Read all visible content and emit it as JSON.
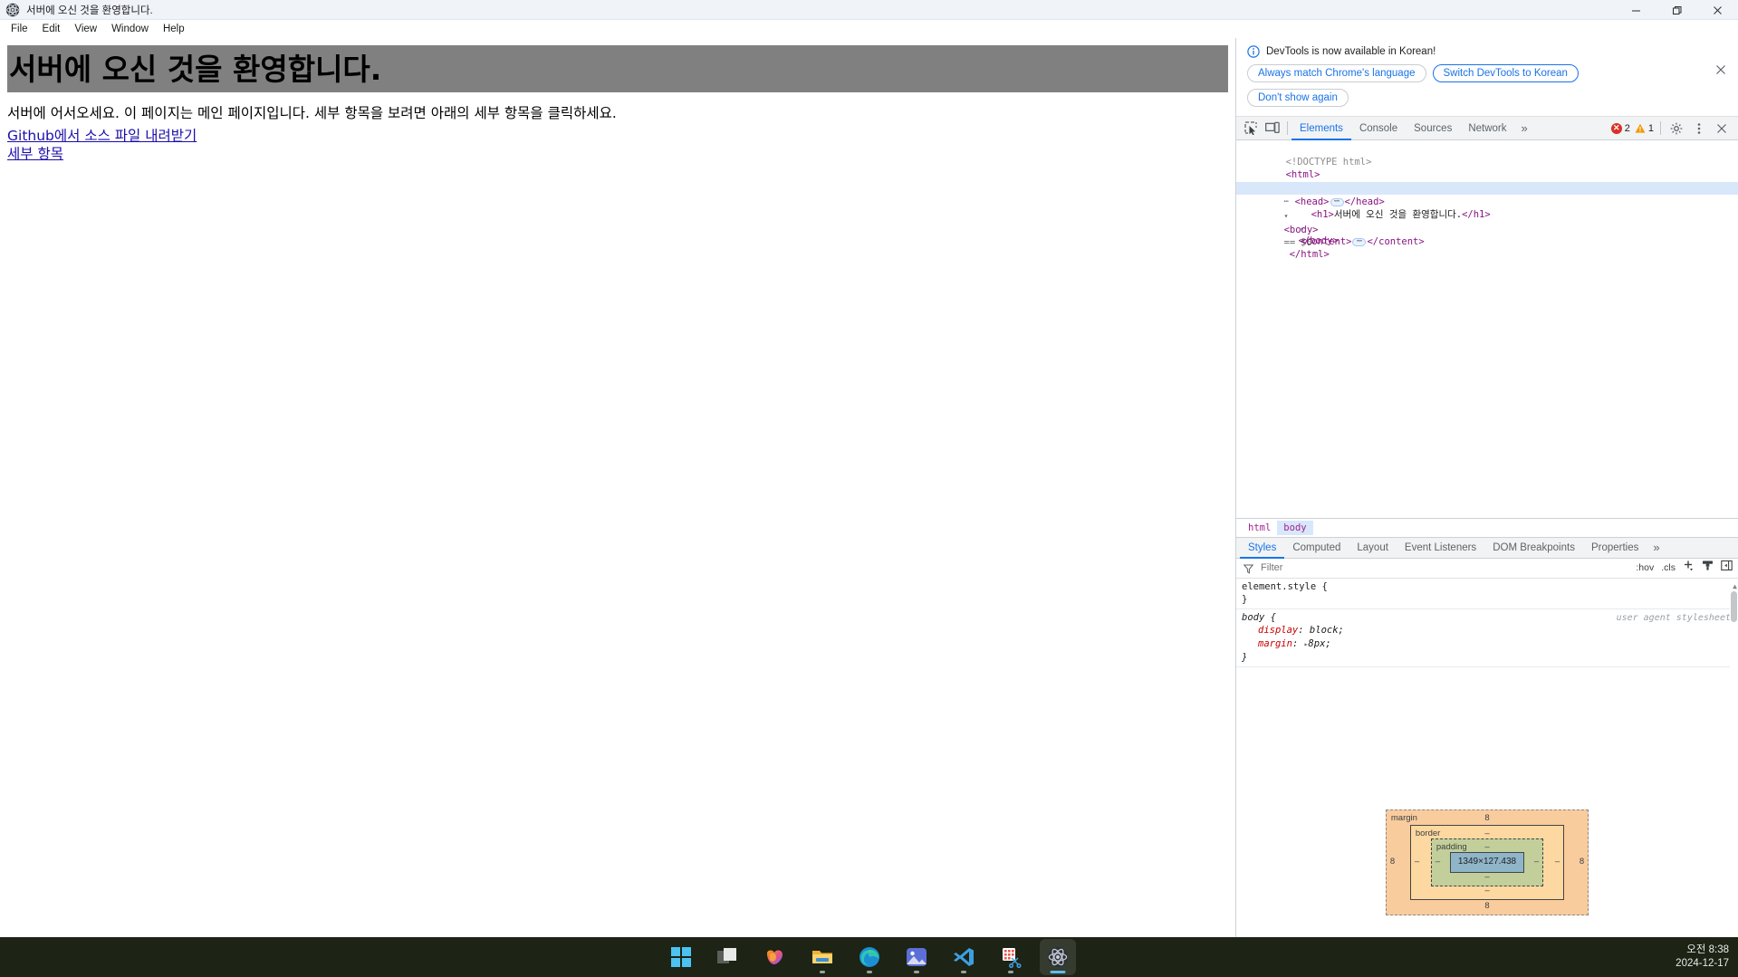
{
  "window": {
    "title": "서버에 오신 것을 환영합니다.",
    "app_icon": "electron-atom-icon",
    "minimize": "—",
    "maximize": "❐",
    "close": "✕"
  },
  "menubar": {
    "items": [
      "File",
      "Edit",
      "View",
      "Window",
      "Help"
    ]
  },
  "page": {
    "heading": "서버에 오신 것을 환영합니다.",
    "paragraph": "서버에 어서오세요. 이 페이지는 메인 페이지입니다. 세부 항목을 보려면 아래의 세부 항목을 클릭하세요.",
    "links": [
      "Github에서 소스 파일 내려받기",
      "세부 항목"
    ],
    "highlight_color": "#808080",
    "link_color": "#1a0dab"
  },
  "devtools": {
    "notice": {
      "icon": "info-icon",
      "message": "DevTools is now available in Korean!",
      "buttons": [
        "Always match Chrome's language",
        "Switch DevTools to Korean",
        "Don't show again"
      ],
      "close": "✕"
    },
    "toolbar": {
      "inspect_icon": "inspect-element-icon",
      "device_icon": "device-toolbar-icon",
      "tabs": [
        "Elements",
        "Console",
        "Sources",
        "Network"
      ],
      "active_tab": "Elements",
      "more_tabs": "»",
      "errors": "2",
      "warnings": "1",
      "settings_icon": "gear-icon",
      "menu_icon": "kebab-menu-icon",
      "close_icon": "close-icon"
    },
    "dom_tree": [
      {
        "indent": 1,
        "kind": "doctype",
        "text": "<!DOCTYPE html>"
      },
      {
        "indent": 1,
        "kind": "tag",
        "text": "<html>"
      },
      {
        "indent": 2,
        "kind": "collapsed",
        "arrow": "▸",
        "open": "<head>",
        "close": "</head>"
      },
      {
        "indent": 1,
        "kind": "selected",
        "arrow": "▾",
        "open": "<body>",
        "suffix": "== $0"
      },
      {
        "indent": 3,
        "kind": "text-node",
        "open": "<h1>",
        "text": "서버에 오신 것을 환영합니다.",
        "close": "</h1>"
      },
      {
        "indent": 2,
        "kind": "collapsed",
        "arrow": "▸",
        "open": "<content>",
        "close": "</content>"
      },
      {
        "indent": 2,
        "kind": "tag",
        "text": "</body>"
      },
      {
        "indent": 1,
        "kind": "tag",
        "text": "</html>"
      }
    ],
    "breadcrumbs": [
      "html",
      "body"
    ],
    "breadcrumb_active": "body",
    "sub_tabs": [
      "Styles",
      "Computed",
      "Layout",
      "Event Listeners",
      "DOM Breakpoints",
      "Properties"
    ],
    "sub_tab_active": "Styles",
    "sub_tabs_more": "»",
    "filter": {
      "icon": "filter-icon",
      "placeholder": "Filter",
      "value": "",
      "tools": [
        ":hov",
        ".cls"
      ],
      "add_rule_icon": "plus-icon",
      "class_icon": "paintbrush-icon",
      "sidebar_icon": "toggle-sidebar-icon"
    },
    "styles": [
      {
        "selector": "element.style",
        "origin": "",
        "declarations": []
      },
      {
        "selector": "body",
        "origin": "user agent stylesheet",
        "declarations": [
          {
            "prop": "display",
            "value": "block;",
            "expandable": false
          },
          {
            "prop": "margin",
            "value": "8px;",
            "expandable": true
          }
        ]
      }
    ],
    "box_model": {
      "margin_label": "margin",
      "border_label": "border",
      "padding_label": "padding",
      "content": "1349×127.438",
      "margin_top": "8",
      "margin_right": "8",
      "margin_bottom": "8",
      "margin_left": "8",
      "border_top": "–",
      "border_right": "–",
      "border_bottom": "–",
      "border_left": "–",
      "padding_top": "–",
      "padding_right": "–",
      "padding_bottom": "–",
      "padding_left": "–"
    }
  },
  "taskbar": {
    "items": [
      {
        "name": "start-button",
        "icon": "windows-logo"
      },
      {
        "name": "task-view-button",
        "icon": "task-view"
      },
      {
        "name": "copilot-button",
        "icon": "copilot"
      },
      {
        "name": "file-explorer-button",
        "icon": "folder"
      },
      {
        "name": "edge-button",
        "icon": "edge"
      },
      {
        "name": "photos-button",
        "icon": "photos"
      },
      {
        "name": "vscode-button",
        "icon": "vscode"
      },
      {
        "name": "snipping-tool-button",
        "icon": "snipping-tool"
      },
      {
        "name": "electron-app-button",
        "icon": "electron-atom"
      }
    ],
    "clock": {
      "time": "오전 8:38",
      "date": "2024-12-17"
    }
  }
}
